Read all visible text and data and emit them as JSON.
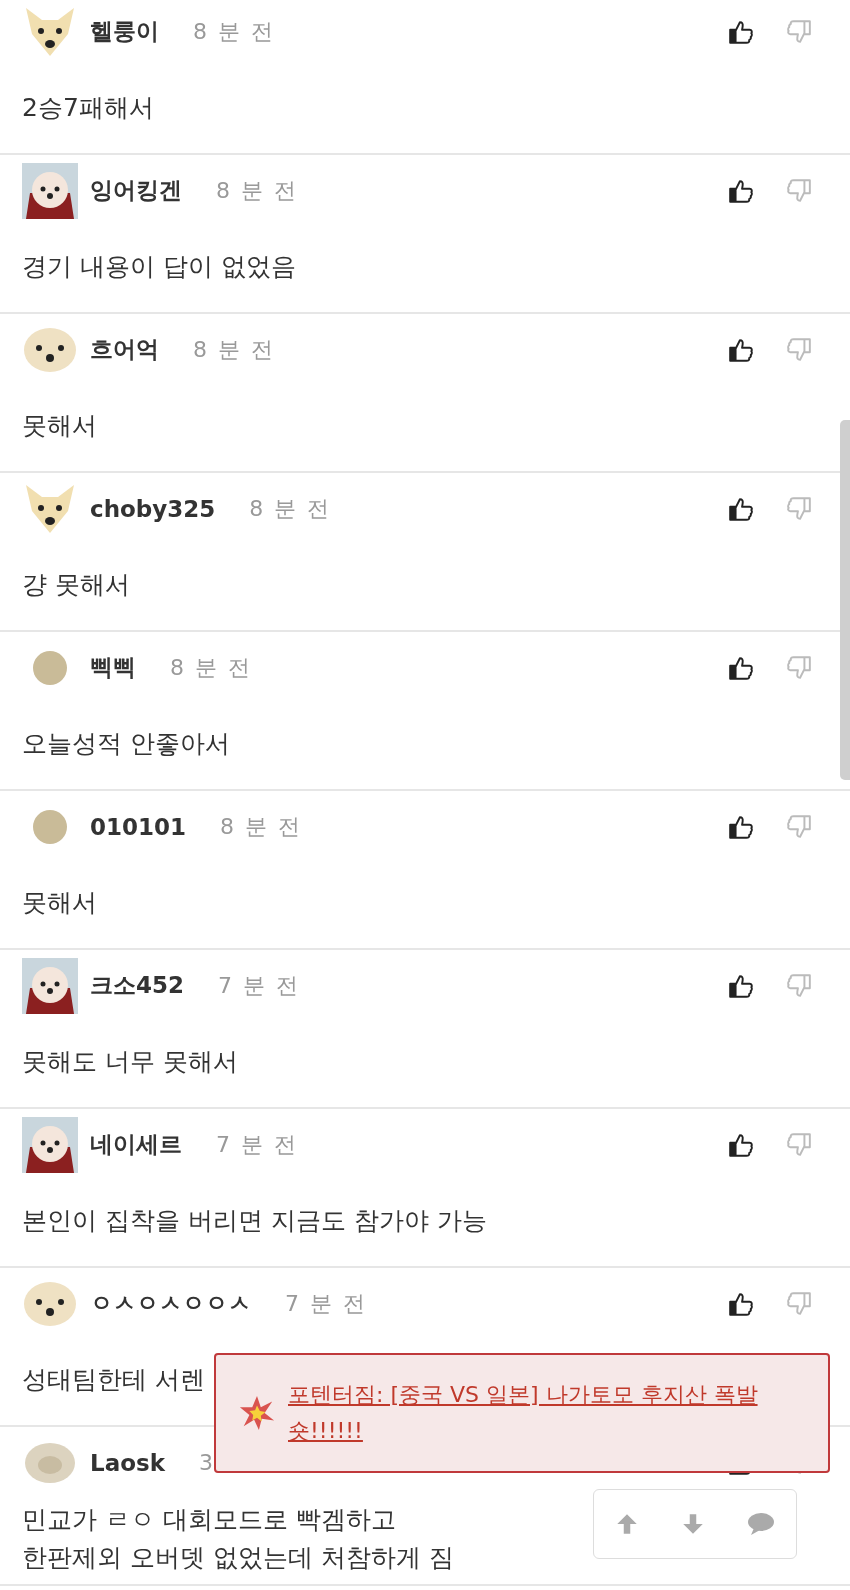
{
  "comments": [
    {
      "kind": "fox",
      "name": "헬룽이",
      "time": "8 분 전",
      "text": [
        "2승7패해서"
      ]
    },
    {
      "kind": "puppy",
      "name": "잉어킹겐",
      "time": "8 분 전",
      "text": [
        "경기 내용이 답이 없었음"
      ]
    },
    {
      "kind": "round",
      "name": "흐어억",
      "time": "8 분 전",
      "text": [
        "못해서"
      ]
    },
    {
      "kind": "fox",
      "name": "choby325",
      "time": "8 분 전",
      "text": [
        "걍 못해서"
      ]
    },
    {
      "kind": "dot",
      "name": "삑삑",
      "time": "8 분 전",
      "text": [
        "오늘성적 안좋아서"
      ]
    },
    {
      "kind": "dot",
      "name": "010101",
      "time": "8 분 전",
      "text": [
        "못해서"
      ]
    },
    {
      "kind": "puppy",
      "name": "크소452",
      "time": "7 분 전",
      "text": [
        "못해도 너무 못해서"
      ]
    },
    {
      "kind": "puppy",
      "name": "네이세르",
      "time": "7 분 전",
      "text": [
        "본인이 집착을 버리면 지금도 참가야 가능"
      ]
    },
    {
      "kind": "round",
      "name": "ㅇㅅㅇㅅㅇㅇㅅ",
      "time": "7 분 전",
      "text": [
        "성태팀한테 서렌"
      ]
    },
    {
      "kind": "blur",
      "name": "Laosk",
      "time": "3",
      "text": [
        "민교가 ㄹㅇ 대회모드로 빡겜하고",
        "한판제외 오버뎃 없었는데 처참하게 짐"
      ]
    }
  ],
  "notice": {
    "link": "포텐터짐: [중국 VS 일본] 나가토모 후지산 폭발숏!!!!!!"
  }
}
